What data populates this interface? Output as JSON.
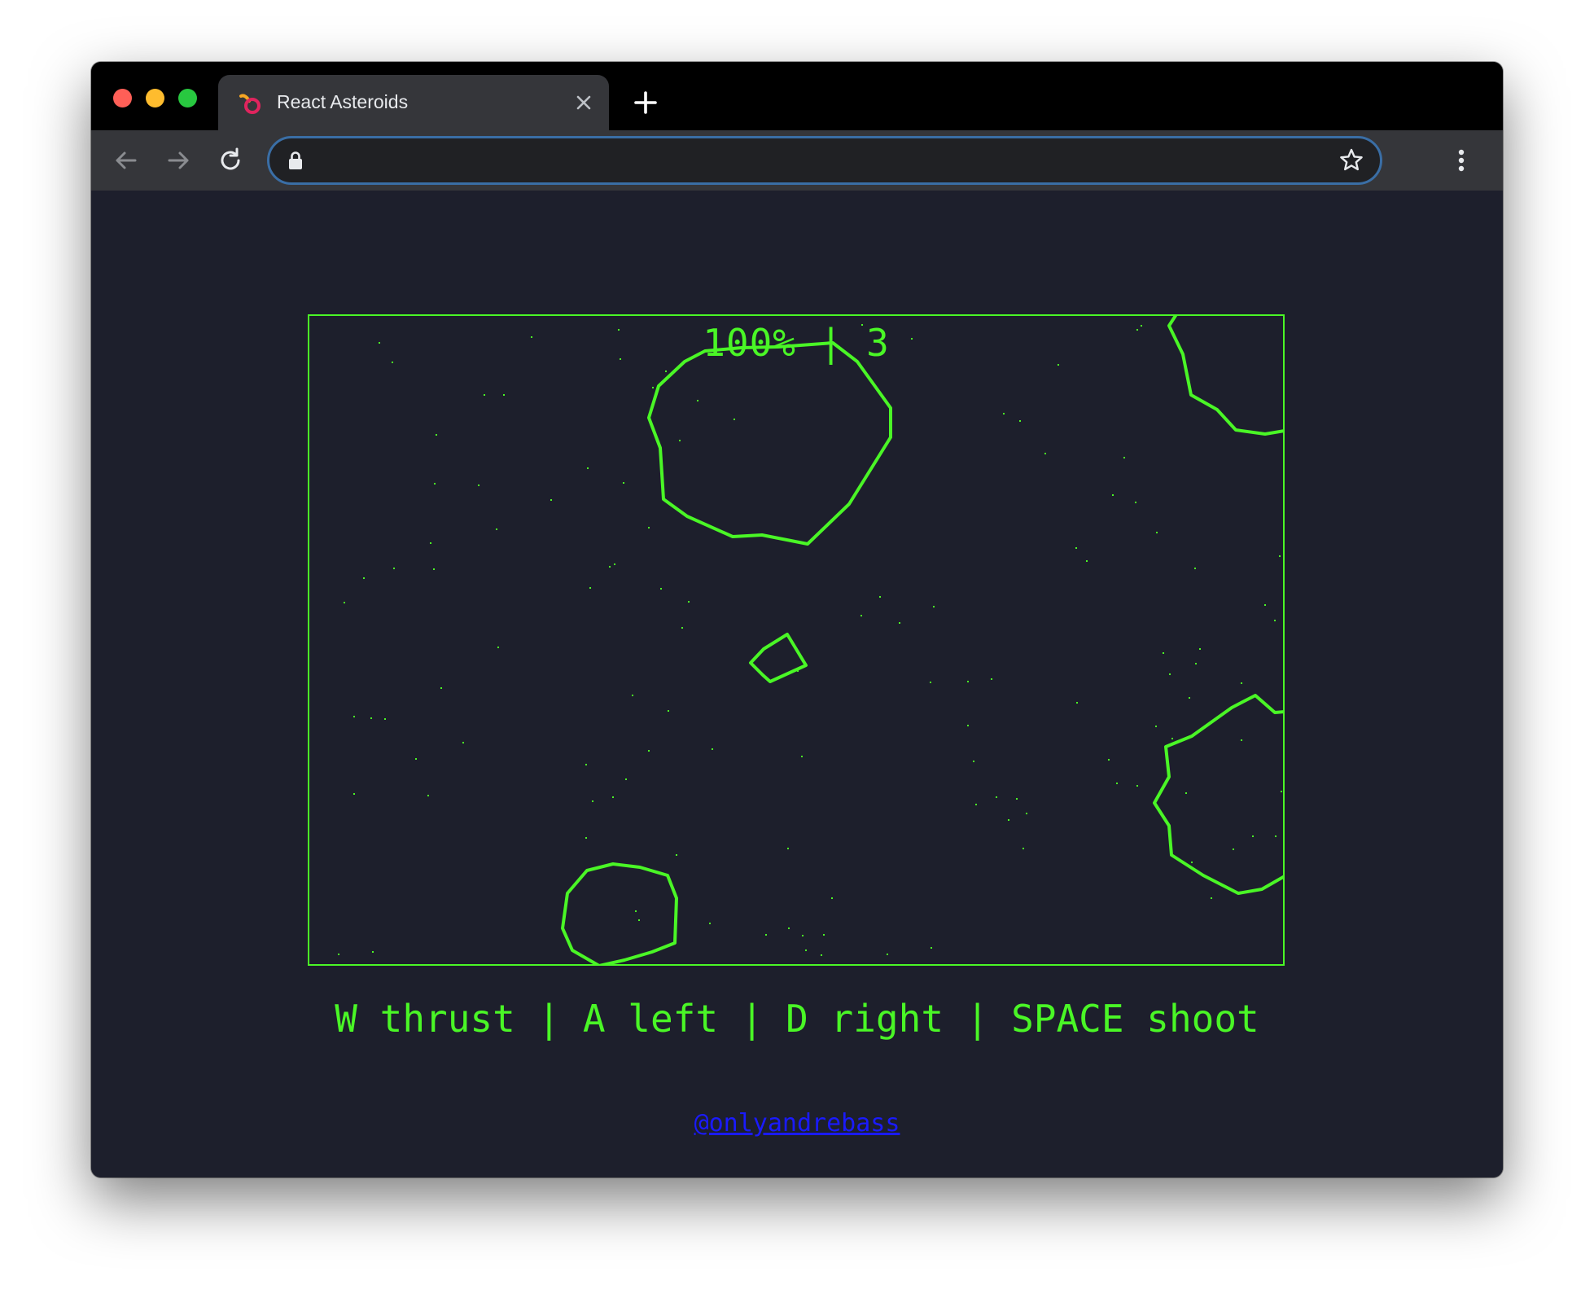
{
  "browser": {
    "tab_title": "React Asteroids",
    "address_value": "",
    "icons": {
      "close_dot": "window-close-dot",
      "minimize_dot": "window-minimize-dot",
      "maximize_dot": "window-maximize-dot",
      "favicon": "react-asteroids-favicon",
      "tab_close": "close-icon",
      "new_tab": "plus-icon",
      "back": "back-arrow-icon",
      "forward": "forward-arrow-icon",
      "reload": "reload-icon",
      "lock": "lock-icon",
      "bookmark": "star-icon",
      "menu": "kebab-menu-icon"
    },
    "colors": {
      "close": "#ff5f57",
      "minimize": "#febc2e",
      "maximize": "#28c840"
    }
  },
  "game": {
    "hud_text": "100% | 3",
    "health_percent": 100,
    "lives": 3,
    "controls_text": "W thrust | A left | D right | SPACE shoot",
    "credit_link": "@onlyandrebass",
    "colors": {
      "accent": "#4af626",
      "background": "#1d1f2c",
      "link": "#1a1aff"
    }
  }
}
